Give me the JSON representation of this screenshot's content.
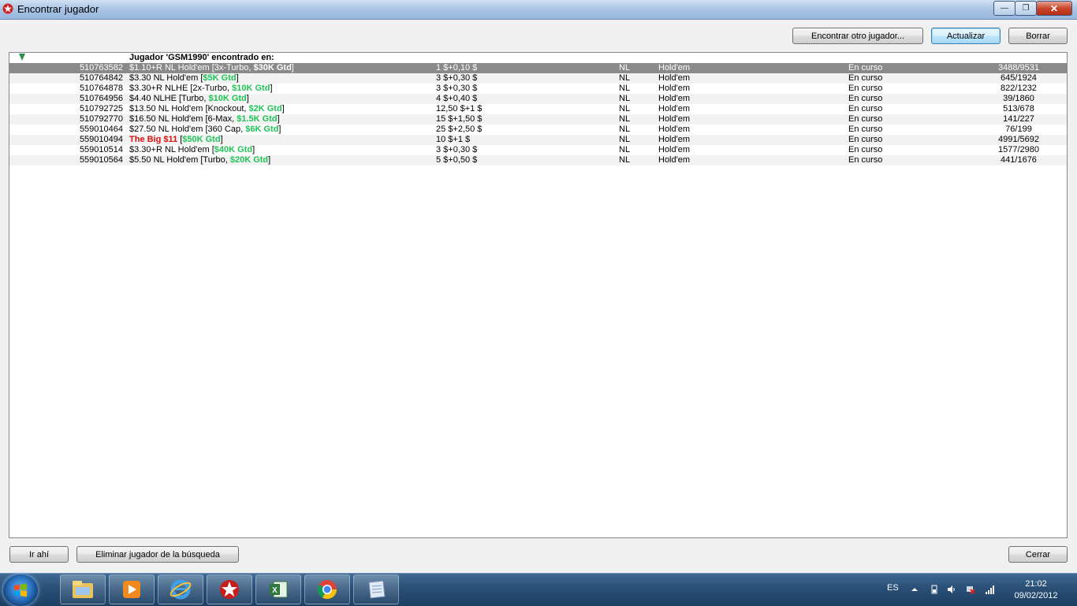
{
  "window": {
    "title": "Encontrar jugador",
    "minimize": "—",
    "maximize": "❐",
    "close": "✕"
  },
  "toolbar": {
    "find_other": "Encontrar otro jugador...",
    "refresh": "Actualizar",
    "delete": "Borrar"
  },
  "list": {
    "header": "Jugador 'GSM1990' encontrado en:",
    "rows": [
      {
        "id": "510763582",
        "name_a": "$1.10+R NL Hold'em [3x-Turbo, ",
        "gtd": "$30K Gtd",
        "name_b": "]",
        "buyin": "1 $+0,10 $",
        "limit": "NL",
        "game": "Hold'em",
        "status": "En curso",
        "players": "3488/9531"
      },
      {
        "id": "510764842",
        "name_a": "$3.30 NL Hold'em [",
        "gtd": "$5K Gtd",
        "name_b": "]",
        "buyin": "3 $+0,30 $",
        "limit": "NL",
        "game": "Hold'em",
        "status": "En curso",
        "players": "645/1924"
      },
      {
        "id": "510764878",
        "name_a": "$3.30+R NLHE [2x-Turbo, ",
        "gtd": "$10K Gtd",
        "name_b": "]",
        "buyin": "3 $+0,30 $",
        "limit": "NL",
        "game": "Hold'em",
        "status": "En curso",
        "players": "822/1232"
      },
      {
        "id": "510764956",
        "name_a": "$4.40 NLHE [Turbo, ",
        "gtd": "$10K Gtd",
        "name_b": "]",
        "buyin": "4 $+0,40 $",
        "limit": "NL",
        "game": "Hold'em",
        "status": "En curso",
        "players": "39/1860"
      },
      {
        "id": "510792725",
        "name_a": "$13.50 NL Hold'em [Knockout, ",
        "gtd": "$2K Gtd",
        "name_b": "]",
        "buyin": "12,50 $+1 $",
        "limit": "NL",
        "game": "Hold'em",
        "status": "En curso",
        "players": "513/678"
      },
      {
        "id": "510792770",
        "name_a": "$16.50 NL Hold'em [6-Max, ",
        "gtd": "$1.5K Gtd",
        "name_b": "]",
        "buyin": "15 $+1,50 $",
        "limit": "NL",
        "game": "Hold'em",
        "status": "En curso",
        "players": "141/227"
      },
      {
        "id": "559010464",
        "name_a": "$27.50 NL Hold'em [360 Cap, ",
        "gtd": "$6K Gtd",
        "name_b": "]",
        "buyin": "25 $+2,50 $",
        "limit": "NL",
        "game": "Hold'em",
        "status": "En curso",
        "players": "76/199"
      },
      {
        "id": "559010494",
        "name_red": "The Big $11",
        "name_a": " [",
        "gtd": "$50K Gtd",
        "name_b": "]",
        "buyin": "10 $+1 $",
        "limit": "NL",
        "game": "Hold'em",
        "status": "En curso",
        "players": "4991/5692"
      },
      {
        "id": "559010514",
        "name_a": "$3.30+R NL Hold'em [",
        "gtd": "$40K Gtd",
        "name_b": "]",
        "buyin": "3 $+0,30 $",
        "limit": "NL",
        "game": "Hold'em",
        "status": "En curso",
        "players": "1577/2980"
      },
      {
        "id": "559010564",
        "name_a": "$5.50 NL Hold'em [Turbo, ",
        "gtd": "$20K Gtd",
        "name_b": "]",
        "buyin": "5 $+0,50 $",
        "limit": "NL",
        "game": "Hold'em",
        "status": "En curso",
        "players": "441/1676"
      }
    ]
  },
  "footer": {
    "go": "Ir ahí",
    "remove": "Eliminar jugador de la búsqueda",
    "close": "Cerrar"
  },
  "taskbar": {
    "items": [
      "explorer-icon",
      "media-player-icon",
      "internet-explorer-icon",
      "pokerstars-icon",
      "excel-icon",
      "chrome-icon",
      "notepad-icon"
    ],
    "language": "ES",
    "time": "21:02",
    "date": "09/02/2012"
  },
  "colors": {
    "gtd_green": "#1fc457",
    "highlight_red": "#e01010",
    "selected_row": "#8a8a8a"
  }
}
